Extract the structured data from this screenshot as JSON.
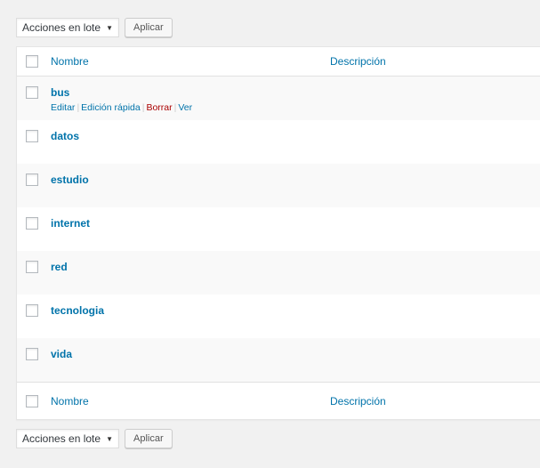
{
  "bulk": {
    "select_value": "Acciones en lote",
    "apply_label": "Aplicar"
  },
  "columns": {
    "name": "Nombre",
    "description": "Descripción"
  },
  "rows": [
    {
      "name": "bus",
      "description": ""
    },
    {
      "name": "datos",
      "description": ""
    },
    {
      "name": "estudio",
      "description": ""
    },
    {
      "name": "internet",
      "description": ""
    },
    {
      "name": "red",
      "description": ""
    },
    {
      "name": "tecnologia",
      "description": ""
    },
    {
      "name": "vida",
      "description": ""
    }
  ],
  "row_actions": {
    "edit": "Editar",
    "quick_edit": "Edición rápida",
    "delete": "Borrar",
    "view": "Ver",
    "separator": "|"
  },
  "colors": {
    "link": "#0073aa",
    "delete": "#aa0000",
    "alt_row": "#f9f9f9",
    "background": "#f1f1f1"
  }
}
